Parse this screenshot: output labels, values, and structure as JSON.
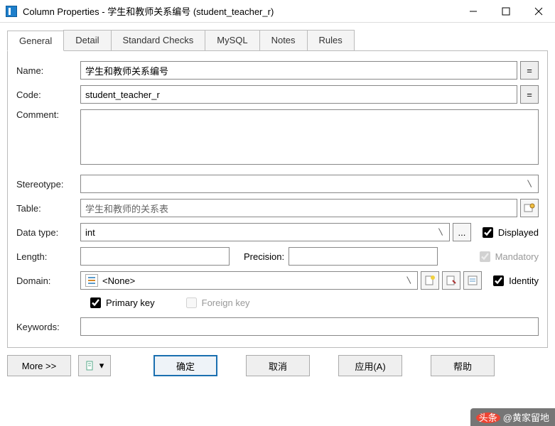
{
  "window": {
    "title": "Column Properties - 学生和教师关系编号 (student_teacher_r)"
  },
  "tabs": {
    "general": "General",
    "detail": "Detail",
    "standard_checks": "Standard Checks",
    "mysql": "MySQL",
    "notes": "Notes",
    "rules": "Rules"
  },
  "labels": {
    "name": "Name:",
    "code": "Code:",
    "comment": "Comment:",
    "stereotype": "Stereotype:",
    "table": "Table:",
    "data_type": "Data type:",
    "length": "Length:",
    "precision": "Precision:",
    "domain": "Domain:",
    "keywords": "Keywords:",
    "displayed": "Displayed",
    "mandatory": "Mandatory",
    "identity": "Identity",
    "primary_key": "Primary key",
    "foreign_key": "Foreign key"
  },
  "values": {
    "name": "学生和教师关系编号",
    "code": "student_teacher_r",
    "comment": "",
    "stereotype": "",
    "table": "学生和教师的关系表",
    "data_type": "int",
    "length": "",
    "precision": "",
    "domain": "<None>",
    "keywords": "",
    "displayed": true,
    "mandatory": true,
    "identity": true,
    "primary_key": true,
    "foreign_key": false
  },
  "buttons": {
    "eq": "=",
    "more": "More >>",
    "ok": "确定",
    "cancel": "取消",
    "apply": "应用(A)",
    "help": "帮助",
    "ellipsis": "..."
  },
  "watermark": "头条 @黄家留地"
}
